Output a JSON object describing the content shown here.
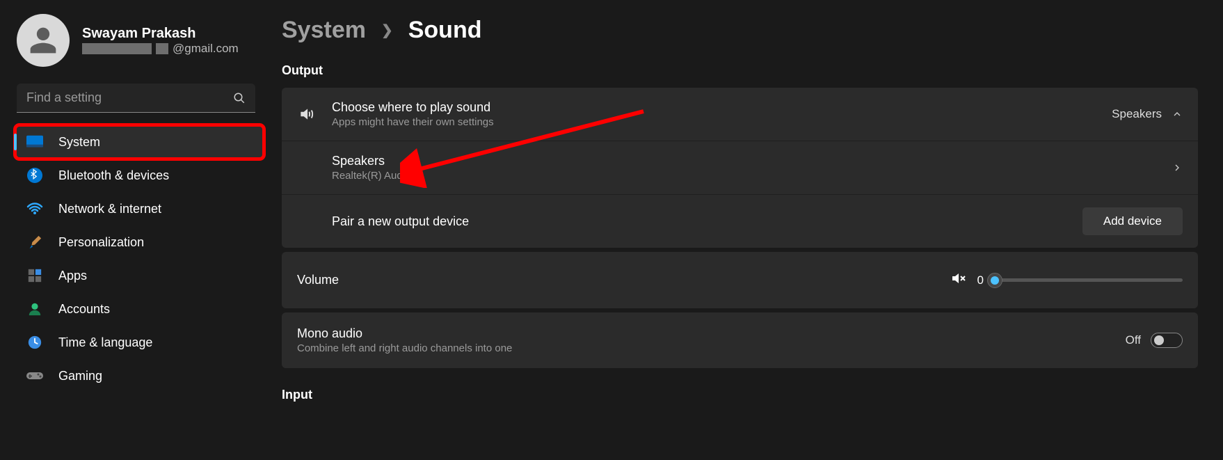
{
  "profile": {
    "name": "Swayam Prakash",
    "email_suffix": "@gmail.com"
  },
  "search": {
    "placeholder": "Find a setting"
  },
  "nav": [
    {
      "label": "System"
    },
    {
      "label": "Bluetooth & devices"
    },
    {
      "label": "Network & internet"
    },
    {
      "label": "Personalization"
    },
    {
      "label": "Apps"
    },
    {
      "label": "Accounts"
    },
    {
      "label": "Time & language"
    },
    {
      "label": "Gaming"
    }
  ],
  "breadcrumb": {
    "parent": "System",
    "current": "Sound"
  },
  "sections": {
    "output": "Output",
    "input": "Input"
  },
  "output": {
    "choose": {
      "title": "Choose where to play sound",
      "sub": "Apps might have their own settings",
      "value": "Speakers"
    },
    "device": {
      "title": "Speakers",
      "sub": "Realtek(R) Audio"
    },
    "pair": {
      "title": "Pair a new output device",
      "button": "Add device"
    }
  },
  "volume": {
    "label": "Volume",
    "value": "0"
  },
  "mono": {
    "title": "Mono audio",
    "sub": "Combine left and right audio channels into one",
    "state": "Off"
  }
}
